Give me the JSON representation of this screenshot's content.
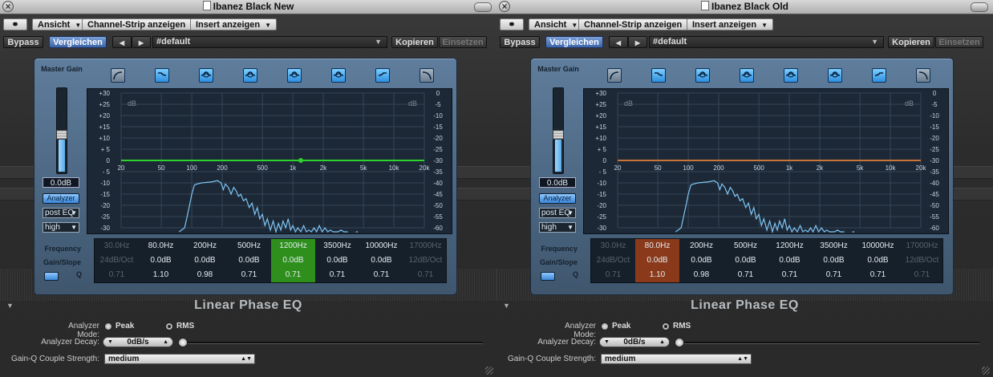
{
  "windows": [
    {
      "title": "Ibanez Black New",
      "toolbar": {
        "view_label": "Ansicht",
        "channel_strip_label": "Channel-Strip anzeigen",
        "insert_label": "Insert anzeigen",
        "bypass_label": "Bypass",
        "compare_label": "Vergleichen",
        "prev_label": "◀",
        "next_label": "▶",
        "preset_value": "#default",
        "copy_label": "Kopieren",
        "paste_label": "Einsetzen"
      },
      "master_gain": {
        "label": "Master Gain",
        "value": "0.0dB",
        "level": 0.45
      },
      "analyzer_button": "Analyzer",
      "analyzer_position": "post EQ",
      "analyzer_resolution": "high",
      "graph": {
        "left_db_ticks": [
          "+30",
          "+25",
          "+20",
          "+15",
          "+10",
          "+ 5",
          "0",
          "- 5",
          "-10",
          "-15",
          "-20",
          "-25",
          "-30"
        ],
        "right_db_ticks": [
          "0",
          "-5",
          "-10",
          "-15",
          "-20",
          "-25",
          "-30",
          "-35",
          "-40",
          "-45",
          "-50",
          "-55",
          "-60"
        ],
        "freq_ticks": [
          "20",
          "50",
          "100",
          "200",
          "500",
          "1k",
          "2k",
          "5k",
          "10k",
          "20k"
        ],
        "db_label": "dB",
        "eq_curve_color": "#2fd12f",
        "analyzer_color": "#7fc4f2"
      },
      "band_labels": {
        "frequency": "Frequency",
        "gain_slope": "Gain/Slope",
        "q": "Q"
      },
      "bands": [
        {
          "freq": "30.0Hz",
          "gain": "24dB/Oct",
          "q": "0.71",
          "state": "off"
        },
        {
          "freq": "80.0Hz",
          "gain": "0.0dB",
          "q": "1.10",
          "state": "on"
        },
        {
          "freq": "200Hz",
          "gain": "0.0dB",
          "q": "0.98",
          "state": "on"
        },
        {
          "freq": "500Hz",
          "gain": "0.0dB",
          "q": "0.71",
          "state": "on"
        },
        {
          "freq": "1200Hz",
          "gain": "0.0dB",
          "q": "0.71",
          "state": "selected"
        },
        {
          "freq": "3500Hz",
          "gain": "0.0dB",
          "q": "0.71",
          "state": "on"
        },
        {
          "freq": "10000Hz",
          "gain": "0.0dB",
          "q": "0.71",
          "state": "on"
        },
        {
          "freq": "17000Hz",
          "gain": "12dB/Oct",
          "q": "0.71",
          "state": "off"
        }
      ],
      "selected_color": "#2e8f1c",
      "plugin_name": "Linear Phase EQ",
      "extended": {
        "analyzer_mode_label": "Analyzer Mode:",
        "mode_peak": "Peak",
        "mode_rms": "RMS",
        "analyzer_decay_label": "Analyzer Decay:",
        "decay_value": "0dB/s",
        "couple_label": "Gain-Q Couple Strength:",
        "couple_value": "medium"
      }
    },
    {
      "title": "Ibanez Black Old",
      "toolbar": {
        "view_label": "Ansicht",
        "channel_strip_label": "Channel-Strip anzeigen",
        "insert_label": "Insert anzeigen",
        "bypass_label": "Bypass",
        "compare_label": "Vergleichen",
        "prev_label": "◀",
        "next_label": "▶",
        "preset_value": "#default",
        "copy_label": "Kopieren",
        "paste_label": "Einsetzen"
      },
      "master_gain": {
        "label": "Master Gain",
        "value": "0.0dB",
        "level": 0.45
      },
      "analyzer_button": "Analyzer",
      "analyzer_position": "post EQ",
      "analyzer_resolution": "high",
      "graph": {
        "left_db_ticks": [
          "+30",
          "+25",
          "+20",
          "+15",
          "+10",
          "+ 5",
          "0",
          "- 5",
          "-10",
          "-15",
          "-20",
          "-25",
          "-30"
        ],
        "right_db_ticks": [
          "0",
          "-5",
          "-10",
          "-15",
          "-20",
          "-25",
          "-30",
          "-35",
          "-40",
          "-45",
          "-50",
          "-55",
          "-60"
        ],
        "freq_ticks": [
          "20",
          "50",
          "100",
          "200",
          "500",
          "1k",
          "2k",
          "5k",
          "10k",
          "20k"
        ],
        "db_label": "dB",
        "eq_curve_color": "#c8743a",
        "analyzer_color": "#7fc4f2"
      },
      "band_labels": {
        "frequency": "Frequency",
        "gain_slope": "Gain/Slope",
        "q": "Q"
      },
      "bands": [
        {
          "freq": "30.0Hz",
          "gain": "24dB/Oct",
          "q": "0.71",
          "state": "off"
        },
        {
          "freq": "80.0Hz",
          "gain": "0.0dB",
          "q": "1.10",
          "state": "selected"
        },
        {
          "freq": "200Hz",
          "gain": "0.0dB",
          "q": "0.98",
          "state": "on"
        },
        {
          "freq": "500Hz",
          "gain": "0.0dB",
          "q": "0.71",
          "state": "on"
        },
        {
          "freq": "1200Hz",
          "gain": "0.0dB",
          "q": "0.71",
          "state": "on"
        },
        {
          "freq": "3500Hz",
          "gain": "0.0dB",
          "q": "0.71",
          "state": "on"
        },
        {
          "freq": "10000Hz",
          "gain": "0.0dB",
          "q": "0.71",
          "state": "on"
        },
        {
          "freq": "17000Hz",
          "gain": "12dB/Oct",
          "q": "0.71",
          "state": "off"
        }
      ],
      "selected_color": "#8a3a1a",
      "plugin_name": "Linear Phase EQ",
      "extended": {
        "analyzer_mode_label": "Analyzer Mode:",
        "mode_peak": "Peak",
        "mode_rms": "RMS",
        "analyzer_decay_label": "Analyzer Decay:",
        "decay_value": "0dB/s",
        "couple_label": "Gain-Q Couple Strength:",
        "couple_value": "medium"
      }
    }
  ]
}
